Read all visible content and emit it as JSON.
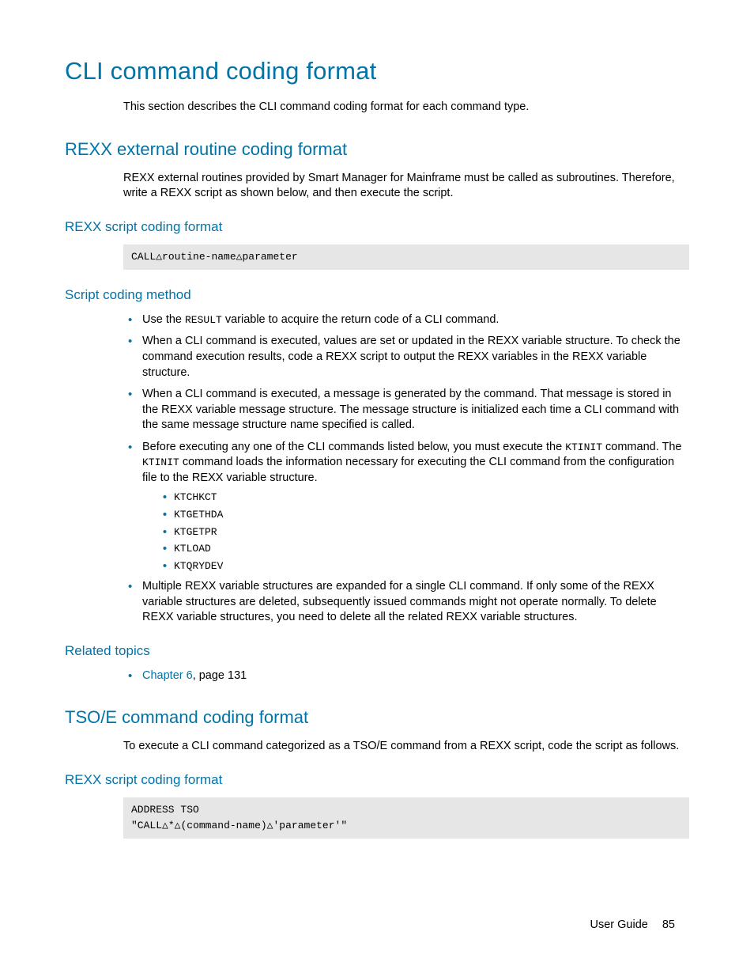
{
  "h1": "CLI command coding format",
  "intro": "This section describes the CLI command coding format for each command type.",
  "rexx_ext": {
    "title": "REXX external routine coding format",
    "para": "REXX external routines provided by Smart Manager for Mainframe must be called as subroutines. Therefore, write a REXX script as shown below, and then execute the script.",
    "script_title": "REXX script coding format",
    "code": "CALL△routine-name△parameter",
    "method_title": "Script coding method",
    "bullets": {
      "b1_pre": "Use the ",
      "b1_mono": "RESULT",
      "b1_post": " variable to acquire the return code of a CLI command.",
      "b2": "When a CLI command is executed, values are set or updated in the REXX variable structure. To check the command execution results, code a REXX script to output the REXX variables in the REXX variable structure.",
      "b3": "When a CLI command is executed, a message is generated by the command. That message is stored in the REXX variable message structure. The message structure is initialized each time a CLI command with the same message structure name specified is called.",
      "b4_pre": "Before executing any one of the CLI commands listed below, you must execute the ",
      "b4_mono1": "KTINIT",
      "b4_mid": " command. The ",
      "b4_mono2": "KTINIT",
      "b4_post": " command loads the information necessary for executing the CLI command from the configuration file to the REXX variable structure.",
      "sub": [
        "KTCHKCT",
        "KTGETHDA",
        "KTGETPR",
        "KTLOAD",
        "KTQRYDEV"
      ],
      "b5": "Multiple REXX variable structures are expanded for a single CLI command. If only some of the REXX variable structures are deleted, subsequently issued commands might not operate normally. To delete REXX variable structures, you need to delete all the related REXX variable structures."
    },
    "related_title": "Related topics",
    "related_link": "Chapter 6",
    "related_rest": ", page 131"
  },
  "tsoe": {
    "title": "TSO/E command coding format",
    "para": "To execute a CLI command categorized as a TSO/E command from a REXX script, code the script as follows.",
    "script_title": "REXX script coding format",
    "code": "ADDRESS TSO\n\"CALL△*△(command-name)△'parameter'\""
  },
  "footer_label": "User Guide",
  "footer_page": "85"
}
